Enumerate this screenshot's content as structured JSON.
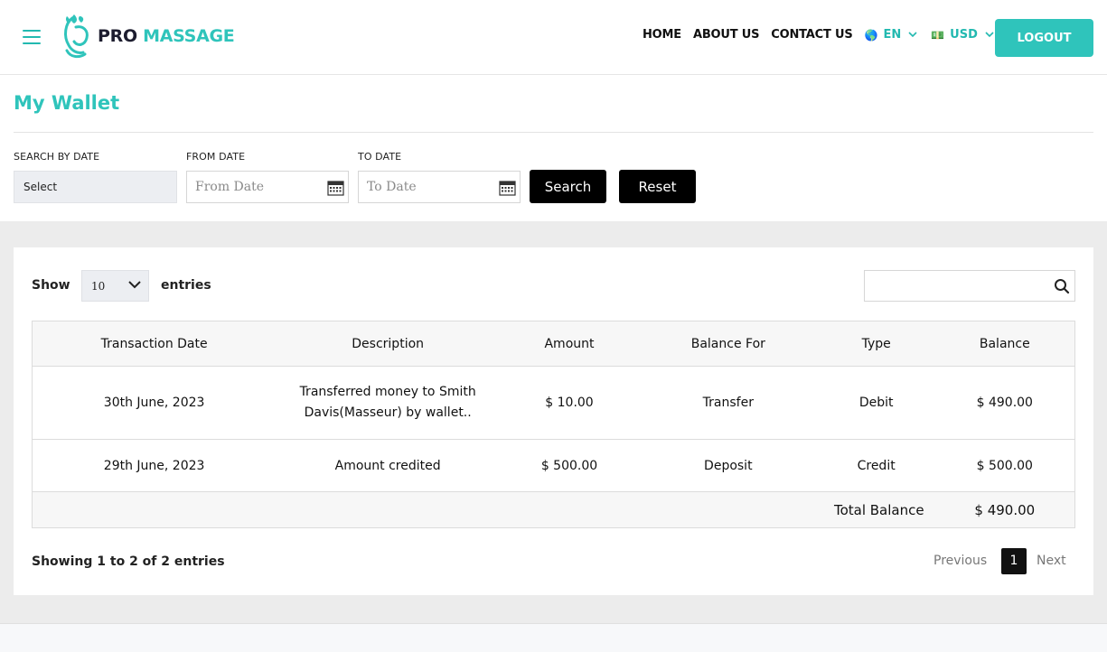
{
  "header": {
    "logo_pro": "PRO",
    "logo_massage": "MASSAGE",
    "nav": [
      "HOME",
      "ABOUT US",
      "CONTACT US"
    ],
    "language": "EN",
    "currency": "USD",
    "logout": "LOGOUT"
  },
  "page": {
    "title": "My Wallet"
  },
  "filters": {
    "search_by_date_label": "SEARCH BY DATE",
    "search_by_date_value": "Select",
    "from_date_label": "FROM DATE",
    "from_date_placeholder": "From Date",
    "to_date_label": "TO DATE",
    "to_date_placeholder": "To Date",
    "search_button": "Search",
    "reset_button": "Reset"
  },
  "table_controls": {
    "show_label": "Show",
    "entries_value": "10",
    "entries_label": "entries"
  },
  "table": {
    "columns": [
      "Transaction Date",
      "Description",
      "Amount",
      "Balance For",
      "Type",
      "Balance"
    ],
    "rows": [
      {
        "date": "30th June, 2023",
        "description": "Transferred money to Smith Davis(Masseur) by wallet..",
        "amount": "$ 10.00",
        "balance_for": "Transfer",
        "type": "Debit",
        "balance": "$ 490.00"
      },
      {
        "date": "29th June, 2023",
        "description": "Amount credited",
        "amount": "$ 500.00",
        "balance_for": "Deposit",
        "type": "Credit",
        "balance": "$ 500.00"
      }
    ],
    "total_label": "Total Balance",
    "total_value": "$ 490.00"
  },
  "pagination": {
    "showing": "Showing 1 to 2 of 2 entries",
    "previous": "Previous",
    "current_page": "1",
    "next": "Next"
  },
  "colors": {
    "accent": "#2fc4bb",
    "dark_button": "#000000",
    "band": "#ececec"
  }
}
